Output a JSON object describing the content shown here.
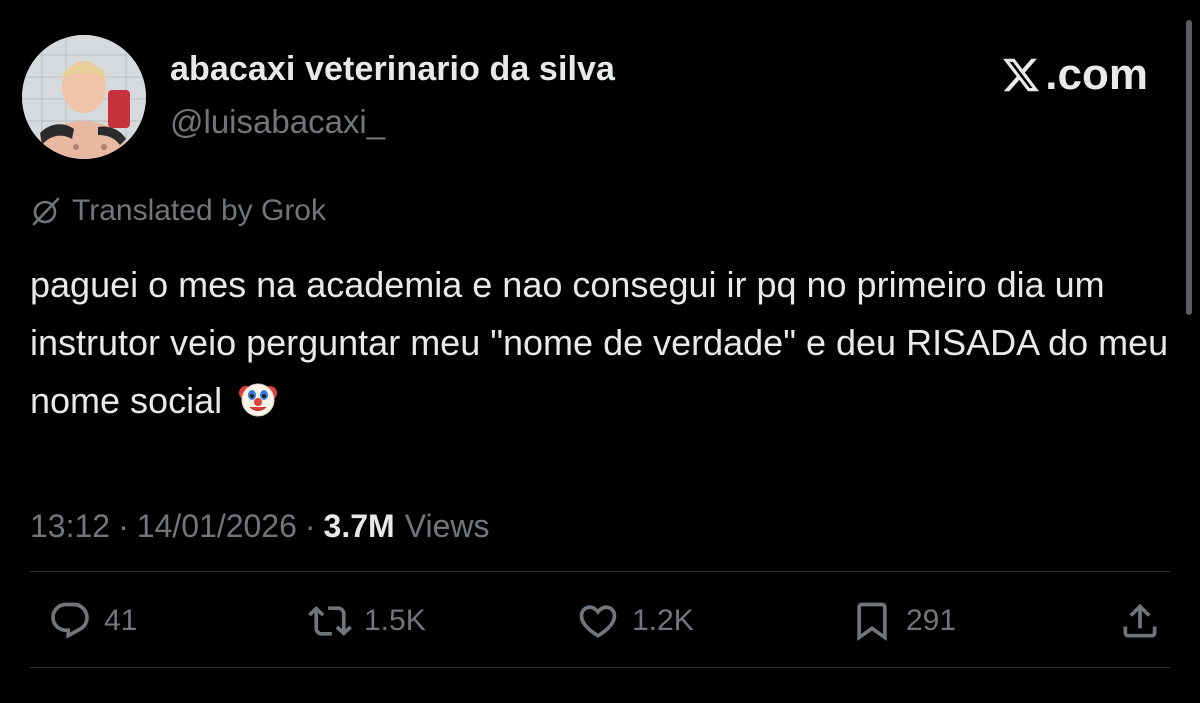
{
  "brand": {
    "label": ".com",
    "logo_icon": "x-logo-icon"
  },
  "author": {
    "display_name": "abacaxi veterinario da silva",
    "handle": "@luisabacaxi_",
    "avatar_icon": "profile-photo"
  },
  "translation": {
    "label": "Translated by Grok",
    "icon": "grok-icon"
  },
  "tweet": {
    "text": "paguei o mes na academia e nao consegui ir pq no primeiro dia um instrutor veio perguntar meu \"nome de verdade\" e deu RISADA do meu nome social",
    "emoji": "clown-face-emoji"
  },
  "meta": {
    "time": "13:12",
    "separator": "·",
    "date": "14/01/2026",
    "views_count": "3.7M",
    "views_label": "Views"
  },
  "actions": {
    "replies": "41",
    "reposts": "1.5K",
    "likes": "1.2K",
    "bookmarks": "291"
  },
  "colors": {
    "background": "#000000",
    "primary_text": "#e7e9ea",
    "secondary_text": "#71767b",
    "divider": "#2f3336"
  }
}
